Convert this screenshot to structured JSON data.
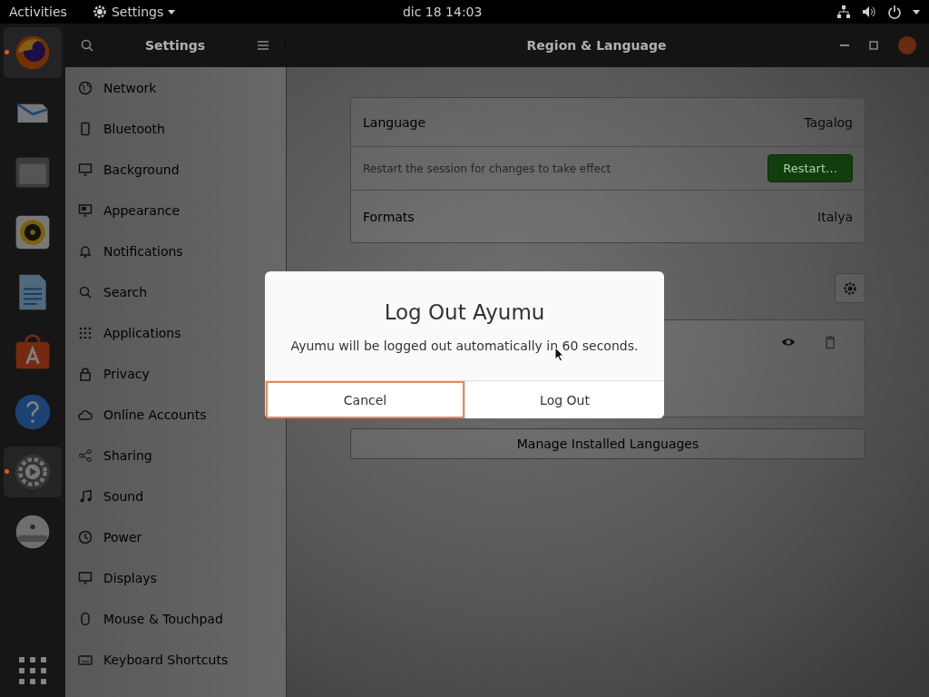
{
  "top_bar": {
    "activities": "Activities",
    "app_menu": "Settings",
    "clock": "dic 18  14:03"
  },
  "dock": [
    {
      "running": true
    },
    {
      "running": false
    },
    {
      "running": false
    },
    {
      "running": false
    },
    {
      "running": false
    },
    {
      "running": false
    },
    {
      "running": false
    },
    {
      "running": true
    },
    {
      "running": false
    }
  ],
  "header": {
    "sidebar_title": "Settings",
    "title": "Region & Language"
  },
  "sidebar": {
    "items": [
      {
        "label": "Network"
      },
      {
        "label": "Bluetooth"
      },
      {
        "label": "Background"
      },
      {
        "label": "Appearance"
      },
      {
        "label": "Notifications"
      },
      {
        "label": "Search"
      },
      {
        "label": "Applications"
      },
      {
        "label": "Privacy"
      },
      {
        "label": "Online Accounts"
      },
      {
        "label": "Sharing"
      },
      {
        "label": "Sound"
      },
      {
        "label": "Power"
      },
      {
        "label": "Displays"
      },
      {
        "label": "Mouse & Touchpad"
      },
      {
        "label": "Keyboard Shortcuts"
      }
    ]
  },
  "region": {
    "language_label": "Language",
    "language_value": "Tagalog",
    "restart_hint": "Restart the session for changes to take effect",
    "restart_button": "Restart…",
    "formats_label": "Formats",
    "formats_value": "Italya",
    "manage_button": "Manage Installed Languages"
  },
  "dialog": {
    "title": "Log Out Ayumu",
    "message": "Ayumu will be logged out automatically in 60 seconds.",
    "buttons": [
      {
        "label": "Cancel",
        "focused": true
      },
      {
        "label": "Log Out",
        "focused": false
      }
    ]
  }
}
